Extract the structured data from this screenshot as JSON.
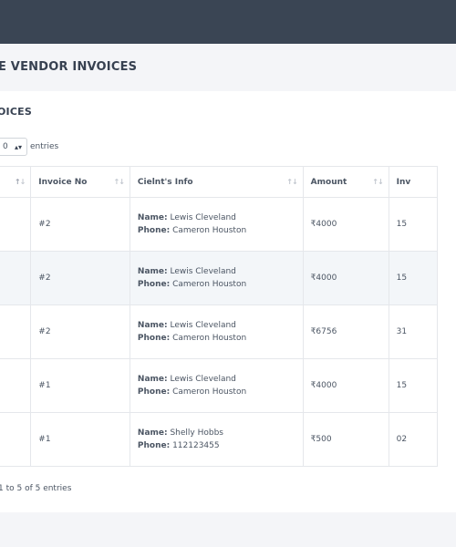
{
  "page": {
    "title": "E VENDOR INVOICES"
  },
  "card": {
    "title": "OICES"
  },
  "length_control": {
    "selected": "0",
    "after_label": "entries"
  },
  "table": {
    "headers": [
      "",
      "Invoice No",
      "Cielnt's Info",
      "Amount",
      "Inv"
    ],
    "rows": [
      {
        "invoice_no": "#2",
        "name_label": "Name:",
        "name": "Lewis Cleveland",
        "phone_label": "Phone:",
        "phone": "Cameron Houston",
        "amount": "₹4000",
        "date": "15"
      },
      {
        "invoice_no": "#2",
        "name_label": "Name:",
        "name": "Lewis Cleveland",
        "phone_label": "Phone:",
        "phone": "Cameron Houston",
        "amount": "₹4000",
        "date": "15"
      },
      {
        "invoice_no": "#2",
        "name_label": "Name:",
        "name": "Lewis Cleveland",
        "phone_label": "Phone:",
        "phone": "Cameron Houston",
        "amount": "₹6756",
        "date": "31"
      },
      {
        "invoice_no": "#1",
        "name_label": "Name:",
        "name": "Lewis Cleveland",
        "phone_label": "Phone:",
        "phone": "Cameron Houston",
        "amount": "₹4000",
        "date": "15"
      },
      {
        "invoice_no": "#1",
        "name_label": "Name:",
        "name": "Shelly Hobbs",
        "phone_label": "Phone:",
        "phone": "112123455",
        "amount": "₹500",
        "date": "02"
      }
    ]
  },
  "footer": {
    "info": "1 to 5 of 5 entries"
  },
  "colors": {
    "topbar": "#3a4554",
    "stripe": "#f3f6f9",
    "page_bg": "#f4f5f8"
  }
}
